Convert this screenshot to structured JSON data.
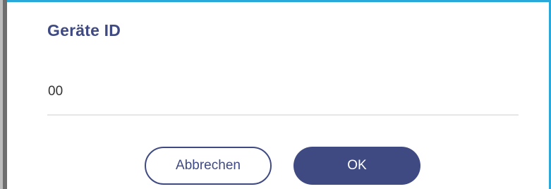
{
  "dialog": {
    "title": "Geräte ID",
    "input_value": "00"
  },
  "buttons": {
    "cancel_label": "Abbrechen",
    "ok_label": "OK"
  },
  "colors": {
    "accent": "#3f4a83",
    "frame_highlight": "#29a9d9"
  }
}
